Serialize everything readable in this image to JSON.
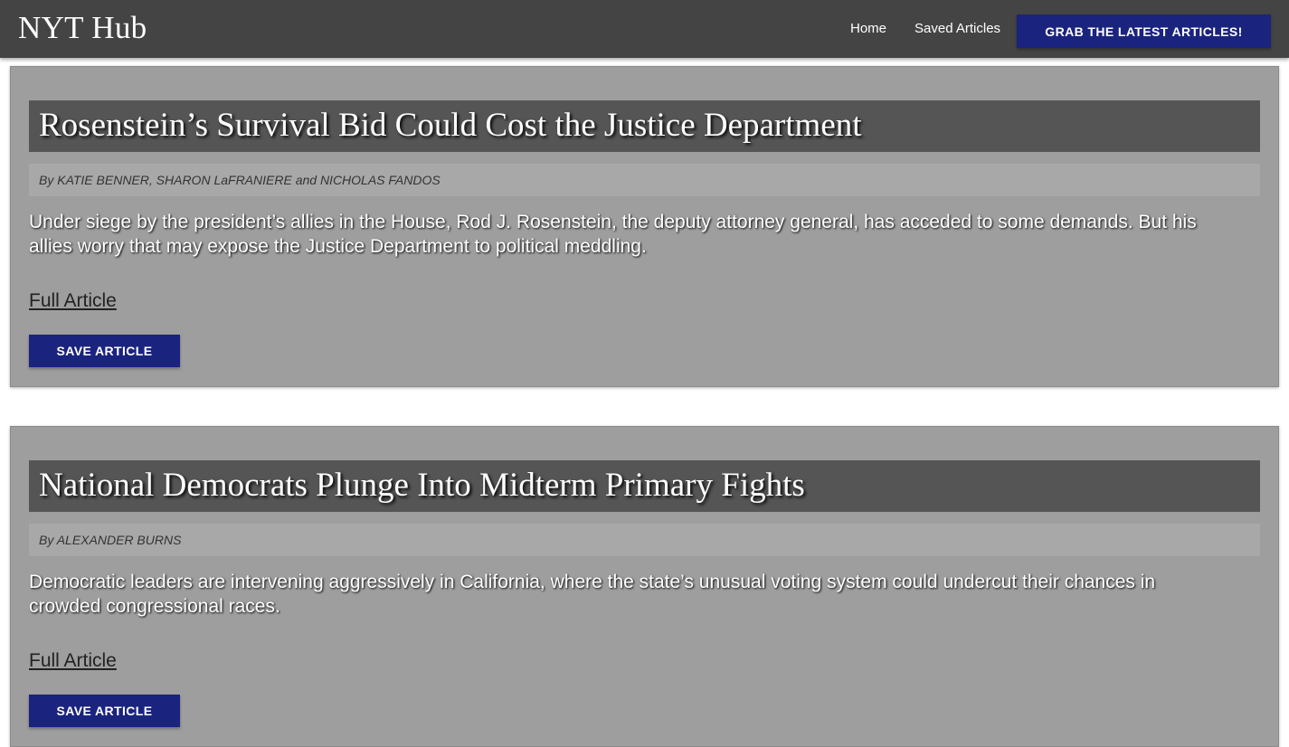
{
  "header": {
    "brand": "NYT Hub",
    "nav": {
      "home": "Home",
      "saved": "Saved Articles",
      "grab_button": "GRAB THE LATEST ARTICLES!"
    }
  },
  "articles": [
    {
      "headline": "Rosenstein’s Survival Bid Could Cost the Justice Department",
      "byline": "By KATIE BENNER, SHARON LaFRANIERE and NICHOLAS FANDOS",
      "summary": "Under siege by the president’s allies in the House, Rod J. Rosenstein, the deputy attorney general, has acceded to some demands. But his allies worry that may expose the Justice Department to political meddling.",
      "link_label": "Full Article",
      "save_label": "SAVE ARTICLE"
    },
    {
      "headline": "National Democrats Plunge Into Midterm Primary Fights",
      "byline": "By ALEXANDER BURNS",
      "summary": "Democratic leaders are intervening aggressively in California, where the state’s unusual voting system could undercut their chances in crowded congressional races.",
      "link_label": "Full Article",
      "save_label": "SAVE ARTICLE"
    }
  ],
  "colors": {
    "navbar": "#444444",
    "accent_button": "#1a237e",
    "card": "#9e9e9e",
    "headline_bar": "#555555",
    "byline_bar": "#a8a8a8"
  }
}
